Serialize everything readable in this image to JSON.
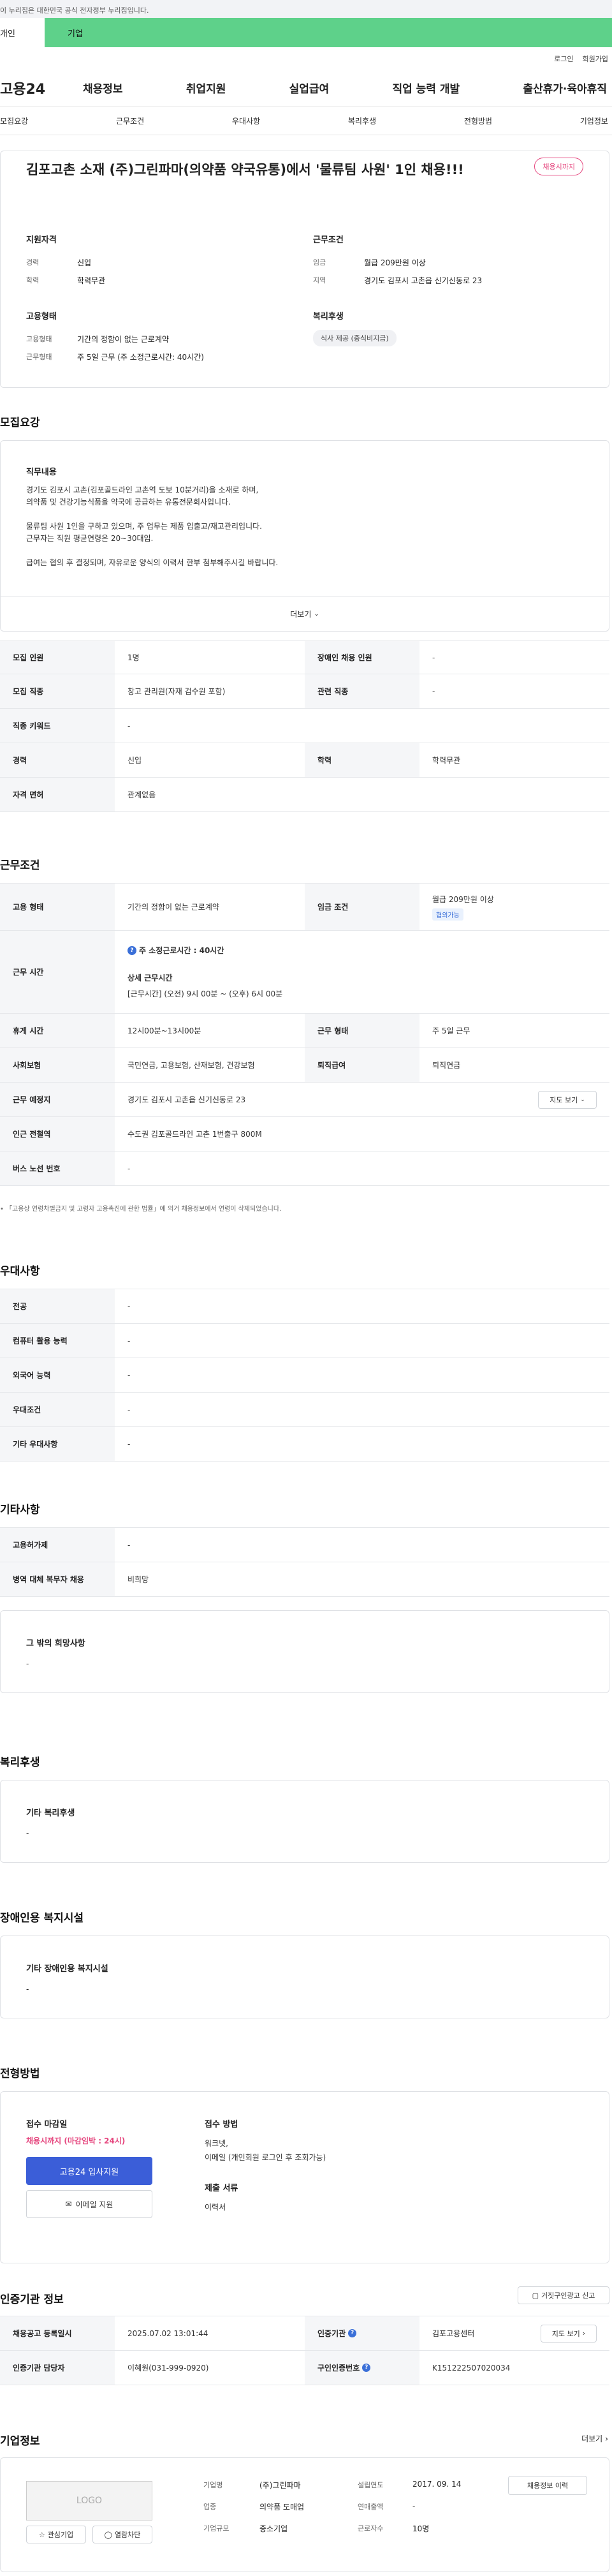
{
  "gov_notice": "이 누리집은 대한민국 공식 전자정부 누리집입니다.",
  "tabs": {
    "personal": "개인",
    "corporate": "기업"
  },
  "utility": {
    "login": "로그인",
    "join": "회원가입"
  },
  "logo": "고용24",
  "gnb": [
    "채용정보",
    "취업지원",
    "실업급여",
    "직업 능력 개발",
    "출산휴가·육아휴직"
  ],
  "subnav": [
    "모집요강",
    "근무조건",
    "우대사항",
    "복리후생",
    "전형방법",
    "기업정보"
  ],
  "job": {
    "title": "김포고촌 소재 (주)그린파마(의약품 약국유통)에서 '물류팀 사원' 1인 채용!!!",
    "badge": "채용시까지",
    "qual_title": "지원자격",
    "qual": [
      {
        "k": "경력",
        "v": "신입"
      },
      {
        "k": "학력",
        "v": "학력무관"
      }
    ],
    "cond_title": "근무조건",
    "cond": [
      {
        "k": "임금",
        "v": "월급 209만원 이상"
      },
      {
        "k": "지역",
        "v": "경기도 김포시 고촌읍 신기신동로 23"
      }
    ],
    "emp_title": "고용형태",
    "emp": [
      {
        "k": "고용형태",
        "v": "기간의 정함이 없는 근로계약"
      },
      {
        "k": "근무형태",
        "v": "주 5일 근무 (주 소정근로시간: 40시간)"
      }
    ],
    "welfare_title": "복리후생",
    "welfare_chip": "식사 제공 (중식비지급)"
  },
  "recruit": {
    "title": "모집요강",
    "desc_title": "직무내용",
    "desc": [
      "경기도 김포시 고촌(김포골드라인 고촌역 도보 10분거리)을 소재로 하며,",
      "의약품 및 건강기능식품을 약국에 공급하는 유통전문회사입니다.",
      "",
      "물류팀 사원 1인을 구하고 있으며, 주 업무는 제품 입출고/재고관리입니다.",
      "근무자는 직원 평균연령은 20~30대임.",
      "",
      "급여는 협의 후 결정되며, 자유로운 양식의 이력서 한부 첨부해주시길 바랍니다."
    ],
    "more": "더보기",
    "rows": [
      [
        {
          "k": "모집 인원",
          "v": "1명"
        },
        {
          "k": "장애인 채용 인원",
          "v": "-"
        }
      ],
      [
        {
          "k": "모집 직종",
          "v": "창고 관리원(자재 검수원 포함)"
        },
        {
          "k": "관련 직종",
          "v": "-"
        }
      ],
      [
        {
          "k": "직종 키워드",
          "v": "-"
        }
      ],
      [
        {
          "k": "경력",
          "v": "신입"
        },
        {
          "k": "학력",
          "v": "학력무관"
        }
      ],
      [
        {
          "k": "자격 면허",
          "v": "관계없음"
        }
      ]
    ]
  },
  "work": {
    "title": "근무조건",
    "emp_k": "고용 형태",
    "emp_v": "기간의 정함이 없는 근로계약",
    "wage_k": "임금 조건",
    "wage_v": "월급 209만원 이상",
    "wage_badge": "협의가능",
    "hours_k": "근무 시간",
    "hours_weekly": "주 소정근로시간 : 40시간",
    "hours_detail_title": "상세 근무시간",
    "hours_detail": "[근무시간] (오전) 9시 00분 ~ (오후) 6시 00분",
    "rows": [
      [
        {
          "k": "휴게 시간",
          "v": "12시00분~13시00분"
        },
        {
          "k": "근무 형태",
          "v": "주 5일 근무"
        }
      ],
      [
        {
          "k": "사회보험",
          "v": "국민연금, 고용보험, 산재보험, 건강보험"
        },
        {
          "k": "퇴직급여",
          "v": "퇴직연금"
        }
      ]
    ],
    "place_k": "근무 예정지",
    "place_v": "경기도 김포시 고촌읍 신기신동로 23",
    "map_btn": "지도 보기",
    "subway_k": "인근 전철역",
    "subway_v": "수도권 김포골드라인 고촌 1번출구 800M",
    "bus_k": "버스 노선 번호",
    "bus_v": "-",
    "note": "「고용상 연령차별금지 및 고령자 고용촉진에 관한 법률」에 의거 채용정보에서 연령이 삭제되었습니다."
  },
  "pref": {
    "title": "우대사항",
    "rows": [
      {
        "k": "전공",
        "v": "-"
      },
      {
        "k": "컴퓨터 활용 능력",
        "v": "-"
      },
      {
        "k": "외국어 능력",
        "v": "-"
      },
      {
        "k": "우대조건",
        "v": "-"
      },
      {
        "k": "기타 우대사항",
        "v": "-"
      }
    ]
  },
  "etc": {
    "title": "기타사항",
    "rows": [
      {
        "k": "고용허가제",
        "v": "-"
      },
      {
        "k": "병역 대체 복무자 채용",
        "v": "비희망"
      }
    ],
    "hope_title": "그 밖의 희망사항",
    "hope_v": "-"
  },
  "benefit": {
    "title": "복리후생",
    "box_title": "기타 복리후생",
    "box_v": "-"
  },
  "disabled": {
    "title": "장애인용 복지시설",
    "box_title": "기타 장애인용 복지시설",
    "box_v": "-"
  },
  "select": {
    "title": "전형방법",
    "deadline_title": "접수 마감일",
    "deadline_v": "채용시까지 (마감임박 : 24시)",
    "apply_btn": "고용24 입사지원",
    "email_btn": "이메일 지원",
    "method_title": "접수 방법",
    "method_lines": [
      "워크넷,",
      "이메일 (개인회원 로그인 후 조회가능)"
    ],
    "docs_title": "제출 서류",
    "docs_v": "이력서"
  },
  "cert": {
    "title": "인증기관 정보",
    "report_btn": "거짓구인광고 신고",
    "reg_k": "채용공고 등록일시",
    "reg_v": "2025.07.02 13:01:44",
    "org_k": "인증기관",
    "org_v": "김포고용센터",
    "map_btn": "지도 보기",
    "manager_k": "인증기관 담당자",
    "manager_v": "이혜원(031-999-0920)",
    "num_k": "구인인증번호",
    "num_v": "K151222507020034"
  },
  "company": {
    "title": "기업정보",
    "more": "더보기",
    "logo": "LOGO",
    "fav_btn": "관심기업",
    "block_btn": "열람차단",
    "info": [
      [
        {
          "k": "기업명",
          "v": "(주)그린파마"
        },
        {
          "k": "설립연도",
          "v": "2017. 09. 14"
        }
      ],
      [
        {
          "k": "업종",
          "v": "의약품 도매업"
        },
        {
          "k": "연매출액",
          "v": "-"
        }
      ],
      [
        {
          "k": "기업규모",
          "v": "중소기업"
        },
        {
          "k": "근로자수",
          "v": "10명"
        }
      ]
    ],
    "jobs_btn": "채용정보 이력"
  }
}
